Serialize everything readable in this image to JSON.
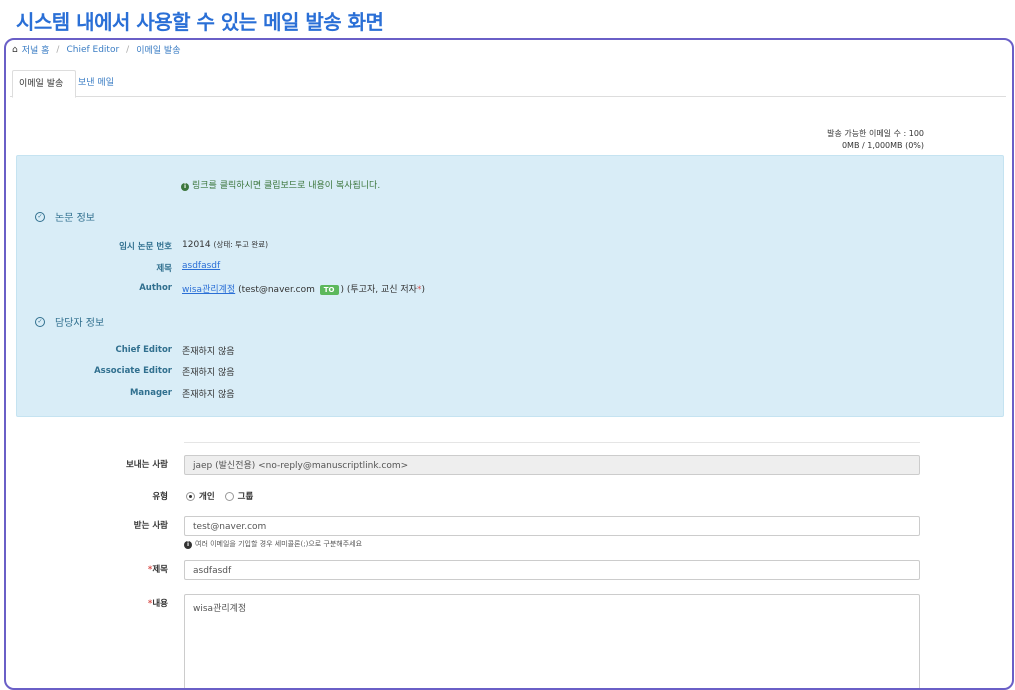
{
  "caption": "시스템 내에서 사용할 수  있는 메일 발송 화면",
  "breadcrumb": {
    "home": "저널 홈",
    "items": [
      "Chief Editor",
      "이메일 발송"
    ]
  },
  "tabs": [
    {
      "label": "이메일 발송"
    },
    {
      "label": "보낸 메일"
    }
  ],
  "quota": {
    "line1": "발송 가능한 이메일 수 : 100",
    "line2": "0MB / 1,000MB (0%)"
  },
  "notice": "링크를 클릭하시면 클립보드로 내용이 복사됩니다.",
  "paper_section": {
    "title": "논문 정보",
    "temp_no_label": "임시 논문 번호",
    "temp_no_value": "12014",
    "temp_no_status": "(상태: 투고 완료)",
    "title_label": "제목",
    "title_value": "asdfasdf",
    "author_label": "Author",
    "author_name": "wisa관리계정",
    "author_email": "(test@naver.com",
    "author_badge": "TO",
    "author_suffix": ") (투고자, 교신 저자",
    "author_mark": "*",
    "author_end": ")"
  },
  "manager_section": {
    "title": "담당자 정보",
    "rows": [
      {
        "label": "Chief Editor",
        "value": "존재하지 않음"
      },
      {
        "label": "Associate Editor",
        "value": "존재하지 않음"
      },
      {
        "label": "Manager",
        "value": "존재하지 않음"
      }
    ]
  },
  "form": {
    "sender_label": "보내는 사람",
    "sender_value": "jaep (발신전용) <no-reply@manuscriptlink.com>",
    "type_label": "유형",
    "type_options": [
      "개인",
      "그룹"
    ],
    "type_selected": "개인",
    "recipient_label": "받는 사람",
    "recipient_value": "test@naver.com",
    "recipient_help": "여러 이메일을 기입할 경우 세미콜론(;)으로 구분해주세요",
    "subject_label": "제목",
    "subject_value": "asdfasdf",
    "body_label": "내용",
    "body_value": "wisa관리계정",
    "required_mark": "*"
  },
  "colors": {
    "accent": "#2a6fd6",
    "info_bg": "#d9edf7",
    "info_text": "#31708f",
    "frame": "#6a5fc7",
    "badge": "#5cb85c"
  }
}
